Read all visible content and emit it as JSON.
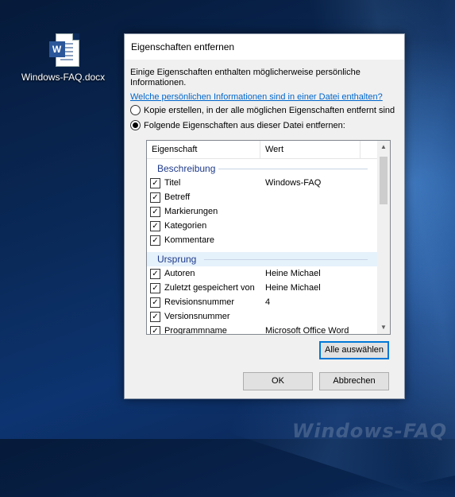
{
  "desktop": {
    "file_icon": "word-document-icon",
    "file_label": "Windows-FAQ.docx",
    "watermark": "Windows-FAQ"
  },
  "dialog": {
    "title": "Eigenschaften entfernen",
    "intro": "Einige Eigenschaften enthalten möglicherweise persönliche Informationen.",
    "help_link": "Welche persönlichen Informationen sind in einer Datei enthalten?",
    "option_copy": "Kopie erstellen, in der alle möglichen Eigenschaften entfernt sind",
    "option_remove": "Folgende Eigenschaften aus dieser Datei entfernen:",
    "selected_option": "remove",
    "list": {
      "col_property": "Eigenschaft",
      "col_value": "Wert",
      "group1": "Beschreibung",
      "group1_rows": [
        {
          "label": "Titel",
          "value": "Windows-FAQ",
          "checked": true
        },
        {
          "label": "Betreff",
          "value": "",
          "checked": true
        },
        {
          "label": "Markierungen",
          "value": "",
          "checked": true
        },
        {
          "label": "Kategorien",
          "value": "",
          "checked": true
        },
        {
          "label": "Kommentare",
          "value": "",
          "checked": true
        }
      ],
      "group2": "Ursprung",
      "group2_rows": [
        {
          "label": "Autoren",
          "value": "Heine Michael",
          "checked": true
        },
        {
          "label": "Zuletzt gespeichert von",
          "value": "Heine Michael",
          "checked": true
        },
        {
          "label": "Revisionsnummer",
          "value": "4",
          "checked": true
        },
        {
          "label": "Versionsnummer",
          "value": "",
          "checked": true
        },
        {
          "label": "Programmname",
          "value": "Microsoft Office Word",
          "checked": true
        }
      ]
    },
    "select_all": "Alle auswählen",
    "ok": "OK",
    "cancel": "Abbrechen",
    "check_mark": "✓",
    "colors": {
      "link": "#0066cc",
      "group_title": "#1e3a8a",
      "focus": "#0078d7"
    }
  }
}
